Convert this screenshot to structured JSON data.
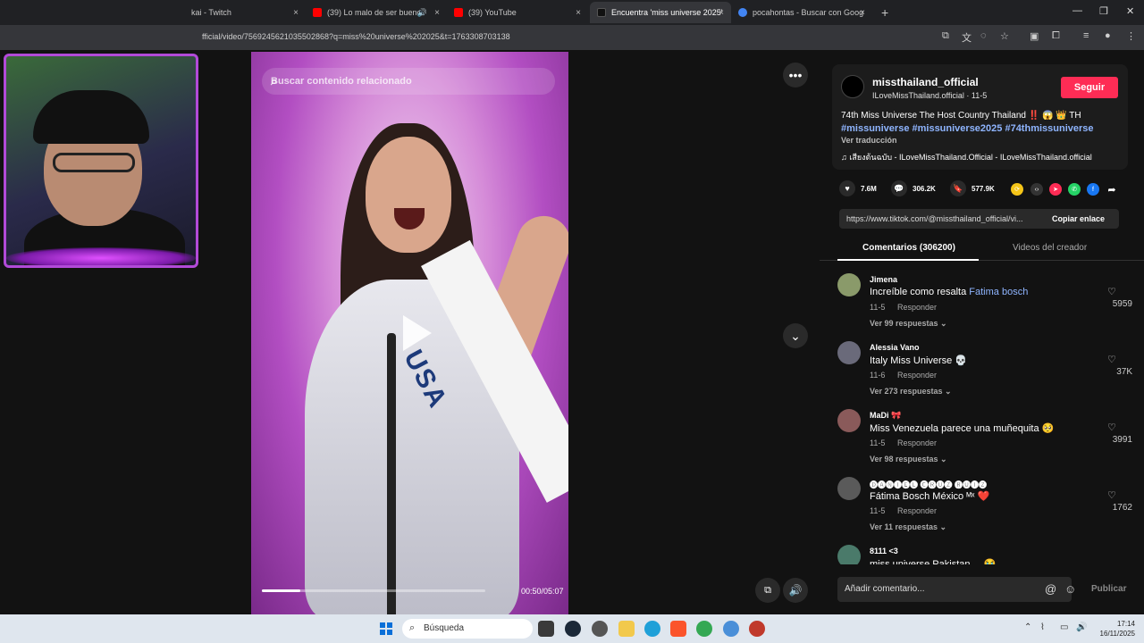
{
  "browser": {
    "tabs": [
      {
        "title": "kai - Twitch",
        "color": "#9146ff"
      },
      {
        "title": "(39) Lo malo de ser bueno",
        "color": "#ff0000"
      },
      {
        "title": "(39) YouTube",
        "color": "#ff0000"
      },
      {
        "title": "Encuentra 'miss universe 2025'",
        "color": "#111111"
      },
      {
        "title": "pocahontas - Buscar con Goog",
        "color": "#4285f4"
      }
    ],
    "new_tab": "+",
    "close": "×",
    "url": "fficial/video/7569245621035502868?q=miss%20universe%202025&t=1763308703138"
  },
  "video": {
    "search_placeholder": "Buscar contenido relacionado",
    "sash_text": "USA",
    "timecode": "00:50/05:07",
    "progress_fraction": 0.17
  },
  "post": {
    "username": "missthailand_official",
    "subname": "ILoveMissThailand.official · 11-5",
    "follow_label": "Seguir",
    "caption": "74th Miss Universe The Host Country Thailand ‼️ 😱 👑 TH",
    "hashtags": "#missuniverse #missuniverse2025 #74thmissuniverse",
    "translate": "Ver traducción",
    "music": "♫  เสียงต้นฉบับ - ILoveMissThailand.Official - ILoveMissThailand.official",
    "likes": "7.6M",
    "comments": "306.2K",
    "saves": "577.9K",
    "link": "https://www.tiktok.com/@missthailand_official/vi...",
    "copy_label": "Copiar enlace"
  },
  "tabs": {
    "comments_label": "Comentarios (306200)",
    "creator_label": "Videos del creador"
  },
  "comments": [
    {
      "name": "Jimena",
      "text_pre": "Increíble como resalta ",
      "text_hl": "Fatima bosch",
      "date": "11-5",
      "reply": "Responder",
      "more": "Ver 99 respuestas ⌄",
      "likes": "5959",
      "avatar": "#8a9a6a"
    },
    {
      "name": "Alessia Vano",
      "text_pre": "Italy Miss Universe 💀",
      "text_hl": "",
      "date": "11-6",
      "reply": "Responder",
      "more": "Ver 273 respuestas ⌄",
      "likes": "37K",
      "avatar": "#6a6a7a"
    },
    {
      "name": "MaDi 🎀",
      "text_pre": "Miss Venezuela parece una muñequita 🥺",
      "text_hl": "",
      "date": "11-5",
      "reply": "Responder",
      "more": "Ver 98 respuestas ⌄",
      "likes": "3991",
      "avatar": "#8a5a5a"
    },
    {
      "name": "🅓🅐🅝🅘🅔🅛 🅒🅡🅤🅩 🅡🅤🅘🅩",
      "text_pre": "Fátima Bosch México ᴹˣ ❤️",
      "text_hl": "",
      "date": "11-5",
      "reply": "Responder",
      "more": "Ver 11 respuestas ⌄",
      "likes": "1762",
      "avatar": "#5a5a5a"
    },
    {
      "name": "8111 <3",
      "text_pre": "miss universe Pakistan ... 😭",
      "text_hl": "",
      "date": "",
      "reply": "",
      "more": "",
      "likes": "",
      "avatar": "#4a7a6a"
    }
  ],
  "compose": {
    "placeholder": "Añadir comentario...",
    "at": "@",
    "emoji": "☺",
    "publish": "Publicar"
  },
  "taskbar": {
    "search": "Búsqueda",
    "time": "17:14",
    "date": "16/11/2025"
  }
}
